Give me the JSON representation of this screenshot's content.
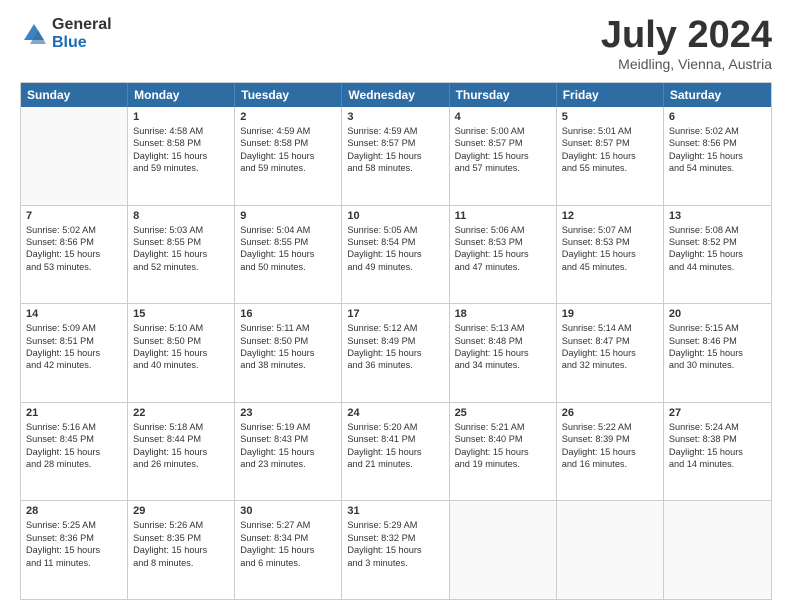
{
  "logo": {
    "general": "General",
    "blue": "Blue"
  },
  "title": "July 2024",
  "location": "Meidling, Vienna, Austria",
  "days": [
    "Sunday",
    "Monday",
    "Tuesday",
    "Wednesday",
    "Thursday",
    "Friday",
    "Saturday"
  ],
  "weeks": [
    [
      {
        "day": "",
        "lines": []
      },
      {
        "day": "1",
        "lines": [
          "Sunrise: 4:58 AM",
          "Sunset: 8:58 PM",
          "Daylight: 15 hours",
          "and 59 minutes."
        ]
      },
      {
        "day": "2",
        "lines": [
          "Sunrise: 4:59 AM",
          "Sunset: 8:58 PM",
          "Daylight: 15 hours",
          "and 59 minutes."
        ]
      },
      {
        "day": "3",
        "lines": [
          "Sunrise: 4:59 AM",
          "Sunset: 8:57 PM",
          "Daylight: 15 hours",
          "and 58 minutes."
        ]
      },
      {
        "day": "4",
        "lines": [
          "Sunrise: 5:00 AM",
          "Sunset: 8:57 PM",
          "Daylight: 15 hours",
          "and 57 minutes."
        ]
      },
      {
        "day": "5",
        "lines": [
          "Sunrise: 5:01 AM",
          "Sunset: 8:57 PM",
          "Daylight: 15 hours",
          "and 55 minutes."
        ]
      },
      {
        "day": "6",
        "lines": [
          "Sunrise: 5:02 AM",
          "Sunset: 8:56 PM",
          "Daylight: 15 hours",
          "and 54 minutes."
        ]
      }
    ],
    [
      {
        "day": "7",
        "lines": [
          "Sunrise: 5:02 AM",
          "Sunset: 8:56 PM",
          "Daylight: 15 hours",
          "and 53 minutes."
        ]
      },
      {
        "day": "8",
        "lines": [
          "Sunrise: 5:03 AM",
          "Sunset: 8:55 PM",
          "Daylight: 15 hours",
          "and 52 minutes."
        ]
      },
      {
        "day": "9",
        "lines": [
          "Sunrise: 5:04 AM",
          "Sunset: 8:55 PM",
          "Daylight: 15 hours",
          "and 50 minutes."
        ]
      },
      {
        "day": "10",
        "lines": [
          "Sunrise: 5:05 AM",
          "Sunset: 8:54 PM",
          "Daylight: 15 hours",
          "and 49 minutes."
        ]
      },
      {
        "day": "11",
        "lines": [
          "Sunrise: 5:06 AM",
          "Sunset: 8:53 PM",
          "Daylight: 15 hours",
          "and 47 minutes."
        ]
      },
      {
        "day": "12",
        "lines": [
          "Sunrise: 5:07 AM",
          "Sunset: 8:53 PM",
          "Daylight: 15 hours",
          "and 45 minutes."
        ]
      },
      {
        "day": "13",
        "lines": [
          "Sunrise: 5:08 AM",
          "Sunset: 8:52 PM",
          "Daylight: 15 hours",
          "and 44 minutes."
        ]
      }
    ],
    [
      {
        "day": "14",
        "lines": [
          "Sunrise: 5:09 AM",
          "Sunset: 8:51 PM",
          "Daylight: 15 hours",
          "and 42 minutes."
        ]
      },
      {
        "day": "15",
        "lines": [
          "Sunrise: 5:10 AM",
          "Sunset: 8:50 PM",
          "Daylight: 15 hours",
          "and 40 minutes."
        ]
      },
      {
        "day": "16",
        "lines": [
          "Sunrise: 5:11 AM",
          "Sunset: 8:50 PM",
          "Daylight: 15 hours",
          "and 38 minutes."
        ]
      },
      {
        "day": "17",
        "lines": [
          "Sunrise: 5:12 AM",
          "Sunset: 8:49 PM",
          "Daylight: 15 hours",
          "and 36 minutes."
        ]
      },
      {
        "day": "18",
        "lines": [
          "Sunrise: 5:13 AM",
          "Sunset: 8:48 PM",
          "Daylight: 15 hours",
          "and 34 minutes."
        ]
      },
      {
        "day": "19",
        "lines": [
          "Sunrise: 5:14 AM",
          "Sunset: 8:47 PM",
          "Daylight: 15 hours",
          "and 32 minutes."
        ]
      },
      {
        "day": "20",
        "lines": [
          "Sunrise: 5:15 AM",
          "Sunset: 8:46 PM",
          "Daylight: 15 hours",
          "and 30 minutes."
        ]
      }
    ],
    [
      {
        "day": "21",
        "lines": [
          "Sunrise: 5:16 AM",
          "Sunset: 8:45 PM",
          "Daylight: 15 hours",
          "and 28 minutes."
        ]
      },
      {
        "day": "22",
        "lines": [
          "Sunrise: 5:18 AM",
          "Sunset: 8:44 PM",
          "Daylight: 15 hours",
          "and 26 minutes."
        ]
      },
      {
        "day": "23",
        "lines": [
          "Sunrise: 5:19 AM",
          "Sunset: 8:43 PM",
          "Daylight: 15 hours",
          "and 23 minutes."
        ]
      },
      {
        "day": "24",
        "lines": [
          "Sunrise: 5:20 AM",
          "Sunset: 8:41 PM",
          "Daylight: 15 hours",
          "and 21 minutes."
        ]
      },
      {
        "day": "25",
        "lines": [
          "Sunrise: 5:21 AM",
          "Sunset: 8:40 PM",
          "Daylight: 15 hours",
          "and 19 minutes."
        ]
      },
      {
        "day": "26",
        "lines": [
          "Sunrise: 5:22 AM",
          "Sunset: 8:39 PM",
          "Daylight: 15 hours",
          "and 16 minutes."
        ]
      },
      {
        "day": "27",
        "lines": [
          "Sunrise: 5:24 AM",
          "Sunset: 8:38 PM",
          "Daylight: 15 hours",
          "and 14 minutes."
        ]
      }
    ],
    [
      {
        "day": "28",
        "lines": [
          "Sunrise: 5:25 AM",
          "Sunset: 8:36 PM",
          "Daylight: 15 hours",
          "and 11 minutes."
        ]
      },
      {
        "day": "29",
        "lines": [
          "Sunrise: 5:26 AM",
          "Sunset: 8:35 PM",
          "Daylight: 15 hours",
          "and 8 minutes."
        ]
      },
      {
        "day": "30",
        "lines": [
          "Sunrise: 5:27 AM",
          "Sunset: 8:34 PM",
          "Daylight: 15 hours",
          "and 6 minutes."
        ]
      },
      {
        "day": "31",
        "lines": [
          "Sunrise: 5:29 AM",
          "Sunset: 8:32 PM",
          "Daylight: 15 hours",
          "and 3 minutes."
        ]
      },
      {
        "day": "",
        "lines": []
      },
      {
        "day": "",
        "lines": []
      },
      {
        "day": "",
        "lines": []
      }
    ]
  ]
}
